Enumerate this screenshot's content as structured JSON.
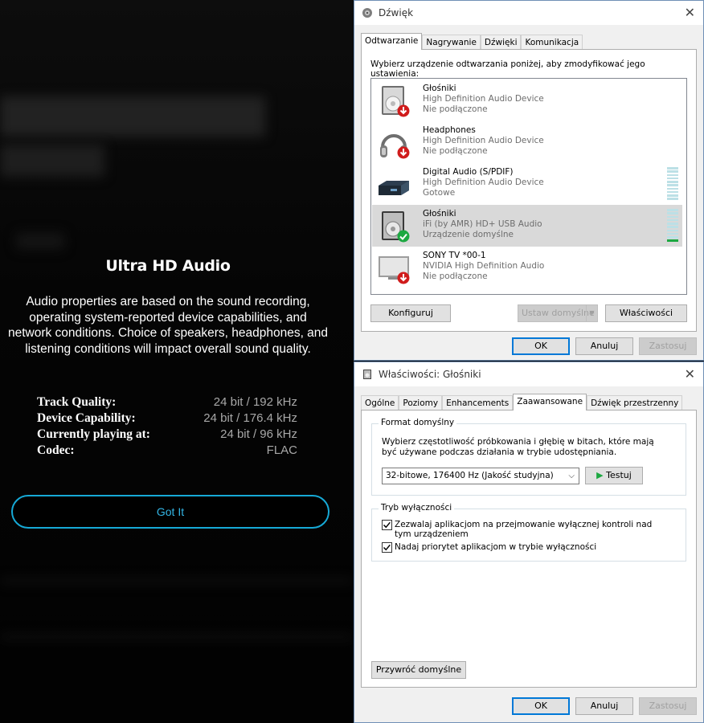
{
  "amazon_dialog": {
    "title": "Ultra HD Audio",
    "description_lines": [
      "Audio properties are based on the sound recording,",
      "operating system-reported device capabilities, and",
      "network conditions. Choice of speakers, headphones, and",
      "listening conditions will impact overall sound quality."
    ],
    "quality_rows": [
      {
        "label": "Track Quality:",
        "value": "24 bit / 192 kHz"
      },
      {
        "label": "Device Capability:",
        "value": "24 bit / 176.4 kHz"
      },
      {
        "label": "Currently playing at:",
        "value": "24 bit / 96 kHz"
      },
      {
        "label": "Codec:",
        "value": "FLAC"
      }
    ],
    "got_it_label": "Got It",
    "accent_color": "#16a9d6"
  },
  "sound_dialog": {
    "title": "Dźwięk",
    "close_glyph": "✕",
    "tabs": [
      "Odtwarzanie",
      "Nagrywanie",
      "Dźwięki",
      "Komunikacja"
    ],
    "active_tab": "Odtwarzanie",
    "instruction": "Wybierz urządzenie odtwarzania poniżej, aby zmodyfikować jego ustawienia:",
    "devices": [
      {
        "name": "Głośniki",
        "driver": "High Definition Audio Device",
        "status": "Nie podłączone",
        "icon": "speaker-icon",
        "badge": "unplugged-icon",
        "selected": false
      },
      {
        "name": "Headphones",
        "driver": "High Definition Audio Device",
        "status": "Nie podłączone",
        "icon": "headphones-icon",
        "badge": "unplugged-icon",
        "selected": false
      },
      {
        "name": "Digital Audio (S/PDIF)",
        "driver": "High Definition Audio Device",
        "status": "Gotowe",
        "icon": "digital-audio-icon",
        "badge": "",
        "selected": false
      },
      {
        "name": "Głośniki",
        "driver": "iFi (by AMR) HD+ USB Audio",
        "status": "Urządzenie domyślne",
        "icon": "speaker-icon",
        "badge": "default-check-icon",
        "selected": true
      },
      {
        "name": "SONY TV  *00-1",
        "driver": "NVIDIA High Definition Audio",
        "status": "Nie podłączone",
        "icon": "monitor-icon",
        "badge": "unplugged-icon",
        "selected": false
      }
    ],
    "buttons": {
      "configure": "Konfiguruj",
      "set_default": "Ustaw domyślne",
      "properties": "Właściwości",
      "ok": "OK",
      "cancel": "Anuluj",
      "apply": "Zastosuj"
    }
  },
  "props_dialog": {
    "title": "Właściwości: Głośniki",
    "close_glyph": "✕",
    "tabs": [
      "Ogólne",
      "Poziomy",
      "Enhancements",
      "Zaawansowane",
      "Dźwięk przestrzenny"
    ],
    "active_tab": "Zaawansowane",
    "format_group": {
      "title": "Format domyślny",
      "description_lines": [
        "Wybierz częstotliwość próbkowania i głębię w bitach, które mają",
        "być używane podczas działania w trybie udostępniania."
      ],
      "selected_format": "32-bitowe, 176400 Hz (Jakość studyjna)",
      "test_button": "Testuj"
    },
    "exclusive_group": {
      "title": "Tryb wyłączności",
      "options": [
        {
          "label_lines": [
            "Zezwalaj aplikacjom na przejmowanie wyłącznej kontroli nad",
            "tym urządzeniem"
          ],
          "checked": true
        },
        {
          "label_lines": [
            "Nadaj priorytet aplikacjom w trybie wyłączności"
          ],
          "checked": true
        }
      ]
    },
    "buttons": {
      "restore_defaults": "Przywróć domyślne",
      "ok": "OK",
      "cancel": "Anuluj",
      "apply": "Zastosuj"
    }
  }
}
